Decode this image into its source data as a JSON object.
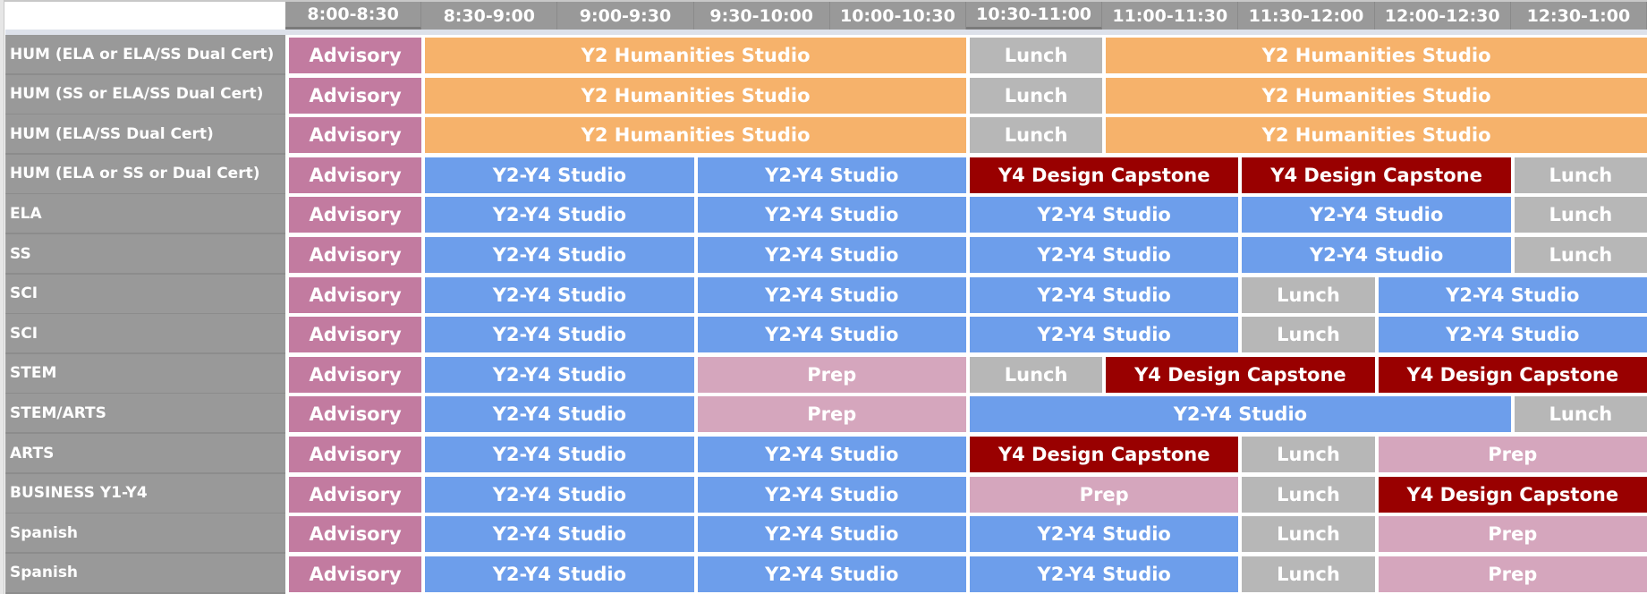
{
  "colors": {
    "Advisory": "#c27ba0",
    "Y2 Humanities Studio": "#f6b26b",
    "Lunch": "#b7b7b7",
    "Y2-Y4 Studio": "#6d9eeb",
    "Y4 Design Capstone": "#990000",
    "Prep": "#d5a6bd"
  },
  "time_slots": [
    "8:00-8:30",
    "8:30-9:00",
    "9:00-9:30",
    "9:30-10:00",
    "10:00-10:30",
    "10:30-11:00",
    "11:00-11:30",
    "11:30-12:00",
    "12:00-12:30",
    "12:30-1:00"
  ],
  "rows": [
    {
      "label": "HUM (ELA or ELA/SS Dual Cert)",
      "blocks": [
        {
          "text": "Advisory",
          "span": 1
        },
        {
          "text": "Y2 Humanities Studio",
          "span": 4
        },
        {
          "text": "Lunch",
          "span": 1
        },
        {
          "text": "Y2 Humanities Studio",
          "span": 4
        }
      ]
    },
    {
      "label": "HUM (SS or ELA/SS Dual Cert)",
      "blocks": [
        {
          "text": "Advisory",
          "span": 1
        },
        {
          "text": "Y2 Humanities Studio",
          "span": 4
        },
        {
          "text": "Lunch",
          "span": 1
        },
        {
          "text": "Y2 Humanities Studio",
          "span": 4
        }
      ]
    },
    {
      "label": "HUM (ELA/SS Dual Cert)",
      "blocks": [
        {
          "text": "Advisory",
          "span": 1
        },
        {
          "text": "Y2 Humanities Studio",
          "span": 4
        },
        {
          "text": "Lunch",
          "span": 1
        },
        {
          "text": "Y2 Humanities Studio",
          "span": 4
        }
      ]
    },
    {
      "label": "HUM (ELA or SS or Dual Cert)",
      "blocks": [
        {
          "text": "Advisory",
          "span": 1
        },
        {
          "text": "Y2-Y4 Studio",
          "span": 2
        },
        {
          "text": "Y2-Y4 Studio",
          "span": 2
        },
        {
          "text": "Y4 Design Capstone",
          "span": 2
        },
        {
          "text": "Y4 Design Capstone",
          "span": 2
        },
        {
          "text": "Lunch",
          "span": 1
        }
      ]
    },
    {
      "label": "ELA",
      "blocks": [
        {
          "text": "Advisory",
          "span": 1
        },
        {
          "text": "Y2-Y4 Studio",
          "span": 2
        },
        {
          "text": "Y2-Y4 Studio",
          "span": 2
        },
        {
          "text": "Y2-Y4 Studio",
          "span": 2
        },
        {
          "text": "Y2-Y4 Studio",
          "span": 2
        },
        {
          "text": "Lunch",
          "span": 1
        }
      ]
    },
    {
      "label": "SS",
      "blocks": [
        {
          "text": "Advisory",
          "span": 1
        },
        {
          "text": "Y2-Y4 Studio",
          "span": 2
        },
        {
          "text": "Y2-Y4 Studio",
          "span": 2
        },
        {
          "text": "Y2-Y4 Studio",
          "span": 2
        },
        {
          "text": "Y2-Y4 Studio",
          "span": 2
        },
        {
          "text": "Lunch",
          "span": 1
        }
      ]
    },
    {
      "label": "SCI",
      "blocks": [
        {
          "text": "Advisory",
          "span": 1
        },
        {
          "text": "Y2-Y4 Studio",
          "span": 2
        },
        {
          "text": "Y2-Y4 Studio",
          "span": 2
        },
        {
          "text": "Y2-Y4 Studio",
          "span": 2
        },
        {
          "text": "Lunch",
          "span": 1
        },
        {
          "text": "Y2-Y4 Studio",
          "span": 2
        }
      ]
    },
    {
      "label": "SCI",
      "blocks": [
        {
          "text": "Advisory",
          "span": 1
        },
        {
          "text": "Y2-Y4 Studio",
          "span": 2
        },
        {
          "text": "Y2-Y4 Studio",
          "span": 2
        },
        {
          "text": "Y2-Y4 Studio",
          "span": 2
        },
        {
          "text": "Lunch",
          "span": 1
        },
        {
          "text": "Y2-Y4 Studio",
          "span": 2
        }
      ]
    },
    {
      "label": "STEM",
      "blocks": [
        {
          "text": "Advisory",
          "span": 1
        },
        {
          "text": "Y2-Y4 Studio",
          "span": 2
        },
        {
          "text": "Prep",
          "span": 2
        },
        {
          "text": "Lunch",
          "span": 1
        },
        {
          "text": "Y4 Design Capstone",
          "span": 2
        },
        {
          "text": "Y4 Design Capstone",
          "span": 2
        }
      ]
    },
    {
      "label": "STEM/ARTS",
      "blocks": [
        {
          "text": "Advisory",
          "span": 1
        },
        {
          "text": "Y2-Y4 Studio",
          "span": 2
        },
        {
          "text": "Prep",
          "span": 2
        },
        {
          "text": "Y2-Y4 Studio",
          "span": 4
        },
        {
          "text": "Lunch",
          "span": 1
        }
      ]
    },
    {
      "label": "ARTS",
      "blocks": [
        {
          "text": "Advisory",
          "span": 1
        },
        {
          "text": "Y2-Y4 Studio",
          "span": 2
        },
        {
          "text": "Y2-Y4 Studio",
          "span": 2
        },
        {
          "text": "Y4 Design Capstone",
          "span": 2
        },
        {
          "text": "Lunch",
          "span": 1
        },
        {
          "text": "Prep",
          "span": 2
        }
      ]
    },
    {
      "label": "BUSINESS Y1-Y4",
      "blocks": [
        {
          "text": "Advisory",
          "span": 1
        },
        {
          "text": "Y2-Y4 Studio",
          "span": 2
        },
        {
          "text": "Y2-Y4 Studio",
          "span": 2
        },
        {
          "text": "Prep",
          "span": 2
        },
        {
          "text": "Lunch",
          "span": 1
        },
        {
          "text": "Y4 Design Capstone",
          "span": 2
        }
      ]
    },
    {
      "label": "Spanish",
      "blocks": [
        {
          "text": "Advisory",
          "span": 1
        },
        {
          "text": "Y2-Y4 Studio",
          "span": 2
        },
        {
          "text": "Y2-Y4 Studio",
          "span": 2
        },
        {
          "text": "Y2-Y4 Studio",
          "span": 2
        },
        {
          "text": "Lunch",
          "span": 1
        },
        {
          "text": "Prep",
          "span": 2
        }
      ]
    },
    {
      "label": "Spanish",
      "blocks": [
        {
          "text": "Advisory",
          "span": 1
        },
        {
          "text": "Y2-Y4 Studio",
          "span": 2
        },
        {
          "text": "Y2-Y4 Studio",
          "span": 2
        },
        {
          "text": "Y2-Y4 Studio",
          "span": 2
        },
        {
          "text": "Lunch",
          "span": 1
        },
        {
          "text": "Prep",
          "span": 2
        }
      ]
    }
  ]
}
